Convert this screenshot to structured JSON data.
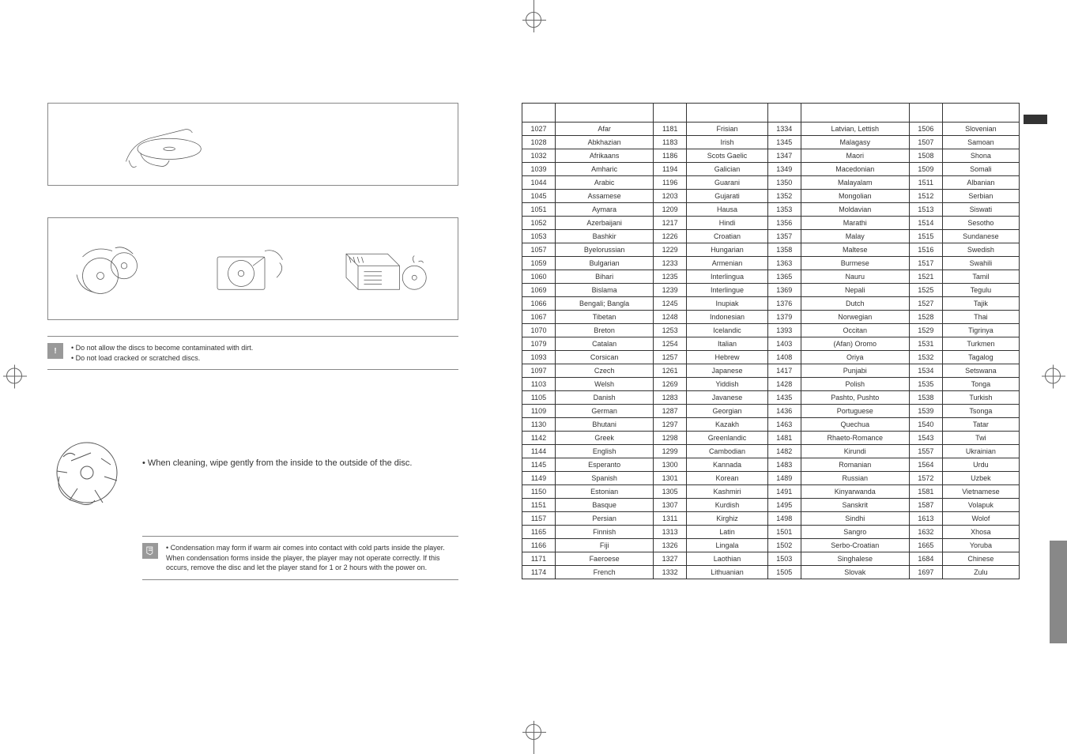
{
  "caution": {
    "icon_symbol": "!",
    "line1": "• Do not allow the discs to become contaminated with dirt.",
    "line2": "• Do not load cracked or scratched discs."
  },
  "cleaning": {
    "text": "• When cleaning, wipe gently from the inside to the outside of the disc."
  },
  "note": {
    "text": "• Condensation may form if warm air comes into contact with cold parts inside the player. When condensation forms inside the player, the player may not operate correctly. If this occurs, remove the disc and let the player stand for 1 or 2 hours with the power on."
  },
  "languages": [
    {
      "c1": "1027",
      "l1": "Afar",
      "c2": "1181",
      "l2": "Frisian",
      "c3": "1334",
      "l3": "Latvian, Lettish",
      "c4": "1506",
      "l4": "Slovenian"
    },
    {
      "c1": "1028",
      "l1": "Abkhazian",
      "c2": "1183",
      "l2": "Irish",
      "c3": "1345",
      "l3": "Malagasy",
      "c4": "1507",
      "l4": "Samoan"
    },
    {
      "c1": "1032",
      "l1": "Afrikaans",
      "c2": "1186",
      "l2": "Scots Gaelic",
      "c3": "1347",
      "l3": "Maori",
      "c4": "1508",
      "l4": "Shona"
    },
    {
      "c1": "1039",
      "l1": "Amharic",
      "c2": "1194",
      "l2": "Galician",
      "c3": "1349",
      "l3": "Macedonian",
      "c4": "1509",
      "l4": "Somali"
    },
    {
      "c1": "1044",
      "l1": "Arabic",
      "c2": "1196",
      "l2": "Guarani",
      "c3": "1350",
      "l3": "Malayalam",
      "c4": "1511",
      "l4": "Albanian"
    },
    {
      "c1": "1045",
      "l1": "Assamese",
      "c2": "1203",
      "l2": "Gujarati",
      "c3": "1352",
      "l3": "Mongolian",
      "c4": "1512",
      "l4": "Serbian"
    },
    {
      "c1": "1051",
      "l1": "Aymara",
      "c2": "1209",
      "l2": "Hausa",
      "c3": "1353",
      "l3": "Moldavian",
      "c4": "1513",
      "l4": "Siswati"
    },
    {
      "c1": "1052",
      "l1": "Azerbaijani",
      "c2": "1217",
      "l2": "Hindi",
      "c3": "1356",
      "l3": "Marathi",
      "c4": "1514",
      "l4": "Sesotho"
    },
    {
      "c1": "1053",
      "l1": "Bashkir",
      "c2": "1226",
      "l2": "Croatian",
      "c3": "1357",
      "l3": "Malay",
      "c4": "1515",
      "l4": "Sundanese"
    },
    {
      "c1": "1057",
      "l1": "Byelorussian",
      "c2": "1229",
      "l2": "Hungarian",
      "c3": "1358",
      "l3": "Maltese",
      "c4": "1516",
      "l4": "Swedish"
    },
    {
      "c1": "1059",
      "l1": "Bulgarian",
      "c2": "1233",
      "l2": "Armenian",
      "c3": "1363",
      "l3": "Burmese",
      "c4": "1517",
      "l4": "Swahili"
    },
    {
      "c1": "1060",
      "l1": "Bihari",
      "c2": "1235",
      "l2": "Interlingua",
      "c3": "1365",
      "l3": "Nauru",
      "c4": "1521",
      "l4": "Tamil"
    },
    {
      "c1": "1069",
      "l1": "Bislama",
      "c2": "1239",
      "l2": "Interlingue",
      "c3": "1369",
      "l3": "Nepali",
      "c4": "1525",
      "l4": "Tegulu"
    },
    {
      "c1": "1066",
      "l1": "Bengali; Bangla",
      "c2": "1245",
      "l2": "Inupiak",
      "c3": "1376",
      "l3": "Dutch",
      "c4": "1527",
      "l4": "Tajik"
    },
    {
      "c1": "1067",
      "l1": "Tibetan",
      "c2": "1248",
      "l2": "Indonesian",
      "c3": "1379",
      "l3": "Norwegian",
      "c4": "1528",
      "l4": "Thai"
    },
    {
      "c1": "1070",
      "l1": "Breton",
      "c2": "1253",
      "l2": "Icelandic",
      "c3": "1393",
      "l3": "Occitan",
      "c4": "1529",
      "l4": "Tigrinya"
    },
    {
      "c1": "1079",
      "l1": "Catalan",
      "c2": "1254",
      "l2": "Italian",
      "c3": "1403",
      "l3": "(Afan) Oromo",
      "c4": "1531",
      "l4": "Turkmen"
    },
    {
      "c1": "1093",
      "l1": "Corsican",
      "c2": "1257",
      "l2": "Hebrew",
      "c3": "1408",
      "l3": "Oriya",
      "c4": "1532",
      "l4": "Tagalog"
    },
    {
      "c1": "1097",
      "l1": "Czech",
      "c2": "1261",
      "l2": "Japanese",
      "c3": "1417",
      "l3": "Punjabi",
      "c4": "1534",
      "l4": "Setswana"
    },
    {
      "c1": "1103",
      "l1": "Welsh",
      "c2": "1269",
      "l2": "Yiddish",
      "c3": "1428",
      "l3": "Polish",
      "c4": "1535",
      "l4": "Tonga"
    },
    {
      "c1": "1105",
      "l1": "Danish",
      "c2": "1283",
      "l2": "Javanese",
      "c3": "1435",
      "l3": "Pashto, Pushto",
      "c4": "1538",
      "l4": "Turkish"
    },
    {
      "c1": "1109",
      "l1": "German",
      "c2": "1287",
      "l2": "Georgian",
      "c3": "1436",
      "l3": "Portuguese",
      "c4": "1539",
      "l4": "Tsonga"
    },
    {
      "c1": "1130",
      "l1": "Bhutani",
      "c2": "1297",
      "l2": "Kazakh",
      "c3": "1463",
      "l3": "Quechua",
      "c4": "1540",
      "l4": "Tatar"
    },
    {
      "c1": "1142",
      "l1": "Greek",
      "c2": "1298",
      "l2": "Greenlandic",
      "c3": "1481",
      "l3": "Rhaeto-Romance",
      "c4": "1543",
      "l4": "Twi"
    },
    {
      "c1": "1144",
      "l1": "English",
      "c2": "1299",
      "l2": "Cambodian",
      "c3": "1482",
      "l3": "Kirundi",
      "c4": "1557",
      "l4": "Ukrainian"
    },
    {
      "c1": "1145",
      "l1": "Esperanto",
      "c2": "1300",
      "l2": "Kannada",
      "c3": "1483",
      "l3": "Romanian",
      "c4": "1564",
      "l4": "Urdu"
    },
    {
      "c1": "1149",
      "l1": "Spanish",
      "c2": "1301",
      "l2": "Korean",
      "c3": "1489",
      "l3": "Russian",
      "c4": "1572",
      "l4": "Uzbek"
    },
    {
      "c1": "1150",
      "l1": "Estonian",
      "c2": "1305",
      "l2": "Kashmiri",
      "c3": "1491",
      "l3": "Kinyarwanda",
      "c4": "1581",
      "l4": "Vietnamese"
    },
    {
      "c1": "1151",
      "l1": "Basque",
      "c2": "1307",
      "l2": "Kurdish",
      "c3": "1495",
      "l3": "Sanskrit",
      "c4": "1587",
      "l4": "Volapuk"
    },
    {
      "c1": "1157",
      "l1": "Persian",
      "c2": "1311",
      "l2": "Kirghiz",
      "c3": "1498",
      "l3": "Sindhi",
      "c4": "1613",
      "l4": "Wolof"
    },
    {
      "c1": "1165",
      "l1": "Finnish",
      "c2": "1313",
      "l2": "Latin",
      "c3": "1501",
      "l3": "Sangro",
      "c4": "1632",
      "l4": "Xhosa"
    },
    {
      "c1": "1166",
      "l1": "Fiji",
      "c2": "1326",
      "l2": "Lingala",
      "c3": "1502",
      "l3": "Serbo-Croatian",
      "c4": "1665",
      "l4": "Yoruba"
    },
    {
      "c1": "1171",
      "l1": "Faeroese",
      "c2": "1327",
      "l2": "Laothian",
      "c3": "1503",
      "l3": "Singhalese",
      "c4": "1684",
      "l4": "Chinese"
    },
    {
      "c1": "1174",
      "l1": "French",
      "c2": "1332",
      "l2": "Lithuanian",
      "c3": "1505",
      "l3": "Slovak",
      "c4": "1697",
      "l4": "Zulu"
    }
  ]
}
